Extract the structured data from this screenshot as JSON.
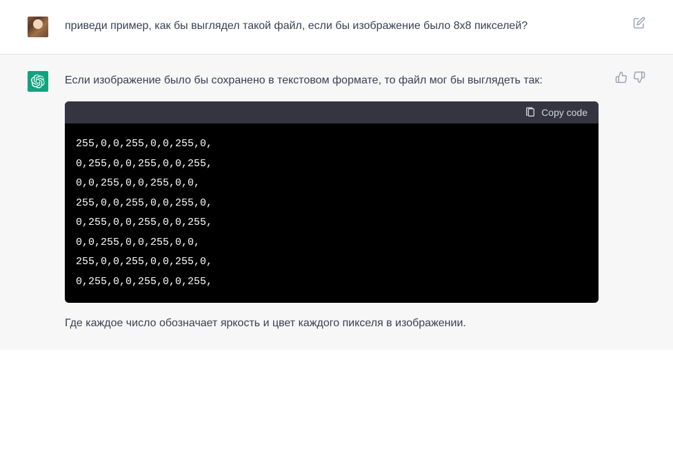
{
  "user_message": {
    "text": "приведи пример, как бы выглядел такой файл, если бы изображение было 8x8 пикселей?"
  },
  "assistant_message": {
    "intro_text": "Если изображение было бы сохранено в текстовом формате, то файл мог бы выглядеть так:",
    "code_lines": [
      "255,0,0,255,0,0,255,0,",
      "0,255,0,0,255,0,0,255,",
      "0,0,255,0,0,255,0,0,",
      "255,0,0,255,0,0,255,0,",
      "0,255,0,0,255,0,0,255,",
      "0,0,255,0,0,255,0,0,",
      "255,0,0,255,0,0,255,0,",
      "0,255,0,0,255,0,0,255,"
    ],
    "outro_text": "Где каждое число обозначает яркость и цвет каждого пикселя в изображении."
  },
  "ui": {
    "copy_label": "Copy code"
  }
}
